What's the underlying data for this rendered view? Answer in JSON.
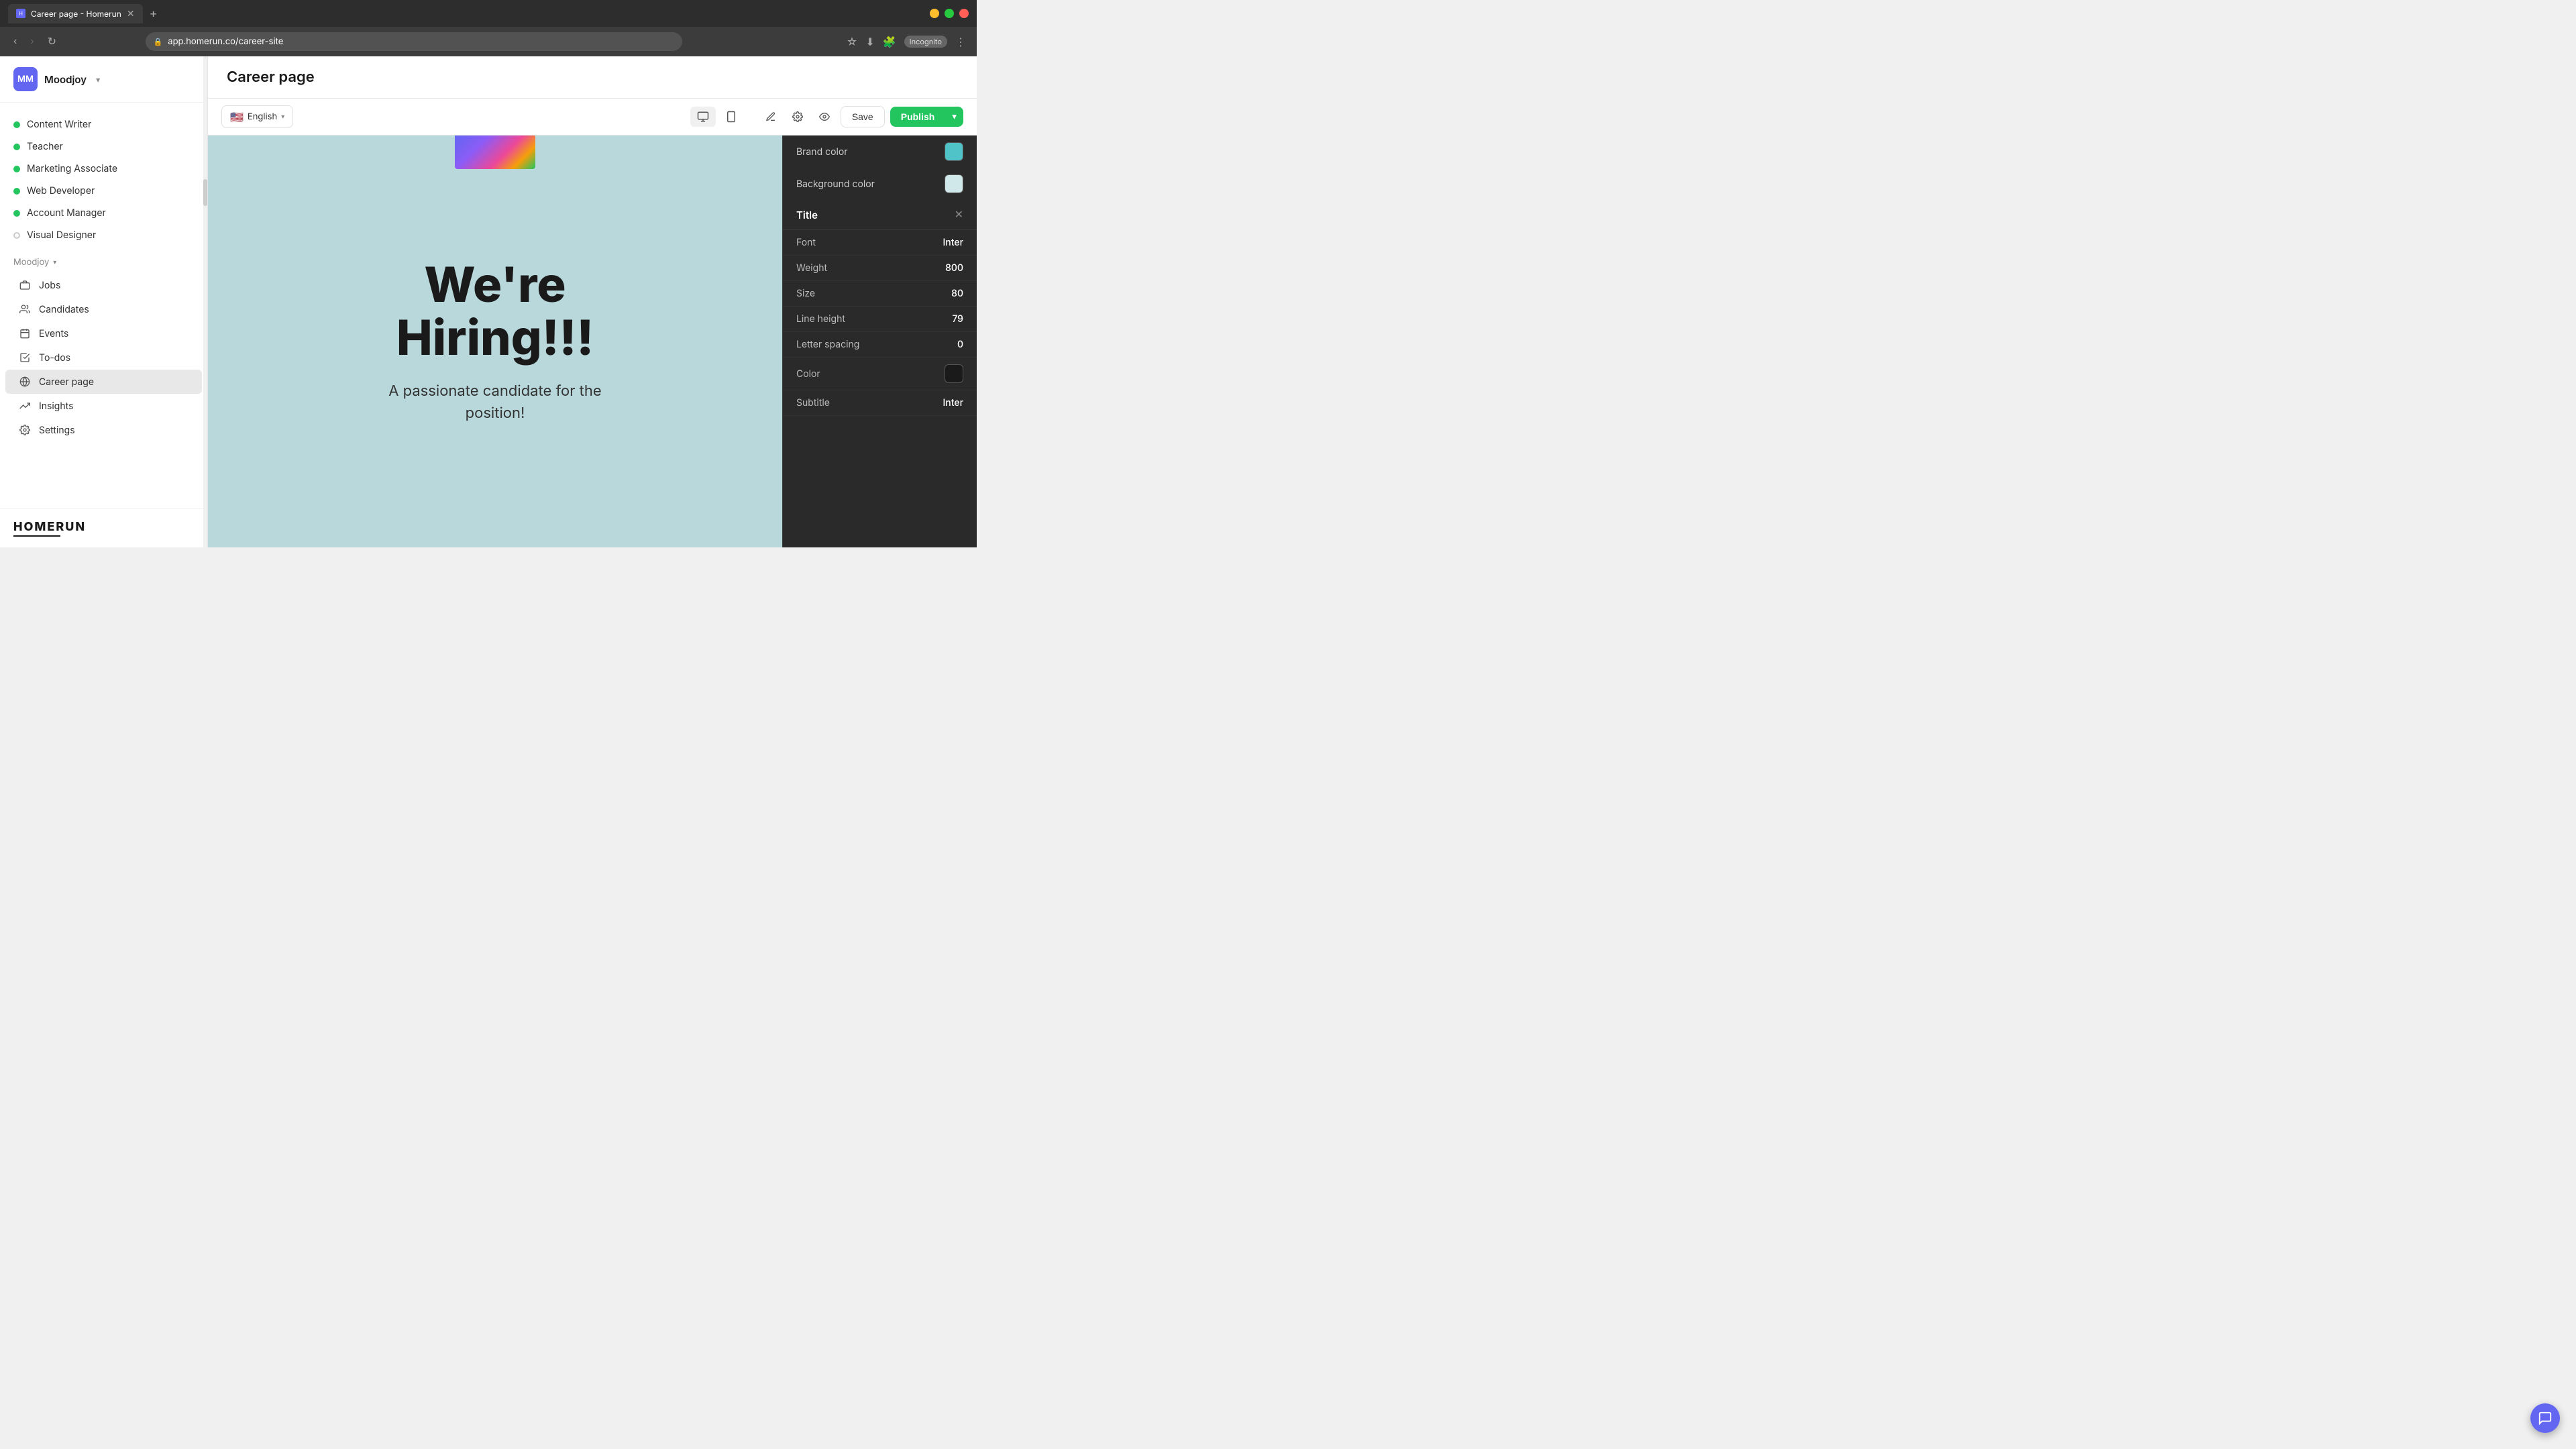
{
  "browser": {
    "tab_title": "Career page - Homerun",
    "tab_favicon": "H",
    "url": "app.homerun.co/career-site",
    "new_tab_label": "+",
    "incognito_label": "Incognito"
  },
  "sidebar": {
    "avatar_initials": "MM",
    "company_name": "Moodjoy",
    "jobs": [
      {
        "name": "Content Writer",
        "status": "active"
      },
      {
        "name": "Teacher",
        "status": "active"
      },
      {
        "name": "Marketing Associate",
        "status": "active"
      },
      {
        "name": "Web Developer",
        "status": "active"
      },
      {
        "name": "Account Manager",
        "status": "active"
      },
      {
        "name": "Visual Designer",
        "status": "inactive"
      }
    ],
    "company_section_label": "Moodjoy",
    "nav_items": [
      {
        "id": "jobs",
        "label": "Jobs",
        "icon": "briefcase"
      },
      {
        "id": "candidates",
        "label": "Candidates",
        "icon": "users"
      },
      {
        "id": "events",
        "label": "Events",
        "icon": "calendar"
      },
      {
        "id": "todos",
        "label": "To-dos",
        "icon": "check-square"
      },
      {
        "id": "career-page",
        "label": "Career page",
        "icon": "globe",
        "active": true
      },
      {
        "id": "insights",
        "label": "Insights",
        "icon": "trending-up"
      },
      {
        "id": "settings",
        "label": "Settings",
        "icon": "settings"
      }
    ],
    "logo_text": "HOMERUN"
  },
  "header": {
    "title": "Career page"
  },
  "toolbar": {
    "language": "English",
    "flag_emoji": "🇺🇸",
    "save_label": "Save",
    "publish_label": "Publish"
  },
  "preview": {
    "title_line1": "We're",
    "title_line2": "Hiring!!!",
    "subtitle": "A passionate candidate for the\nposition!"
  },
  "right_panel": {
    "brand_color_label": "Brand color",
    "background_color_label": "Background color",
    "title_section_label": "Title",
    "font_label": "Font",
    "font_value": "Inter",
    "weight_label": "Weight",
    "weight_value": "800",
    "size_label": "Size",
    "size_value": "80",
    "line_height_label": "Line height",
    "line_height_value": "79",
    "letter_spacing_label": "Letter spacing",
    "letter_spacing_value": "0",
    "color_label": "Color",
    "subtitle_label": "Subtitle",
    "subtitle_value": "Inter"
  }
}
